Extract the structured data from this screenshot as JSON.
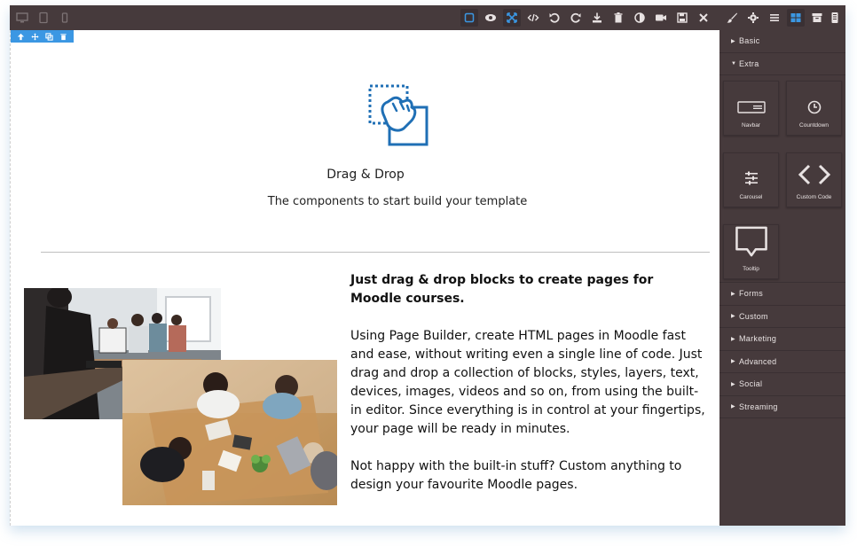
{
  "topbar": {
    "left_icons": [
      "desktop-icon",
      "tablet-icon",
      "mobile-icon"
    ],
    "right_icons": [
      "square-outline-icon",
      "eye-icon",
      "fullscreen-icon",
      "code-icon",
      "undo-icon",
      "redo-icon",
      "import-icon",
      "trash-icon",
      "contrast-icon",
      "video-icon",
      "save-icon",
      "close-icon",
      "brush-icon",
      "gear-icon",
      "layers-icon",
      "blocks-icon",
      "archive-icon",
      "phone-list-icon"
    ]
  },
  "selection_toolbar": {
    "icons": [
      "arrow-up-icon",
      "move-icon",
      "clone-icon",
      "delete-icon"
    ]
  },
  "canvas": {
    "dd_title": "Drag & Drop",
    "dd_subtitle": "The components to start build your template",
    "heading": "Just drag & drop blocks to create pages for Moodle courses.",
    "paragraph1": "Using Page Builder, create HTML pages in Moodle fast and ease, without writing even a single line of code. Just drag and drop a collection of blocks, styles, layers, text, devices, images, videos and so on, from using the built-in editor. Since everything is in control at your fingertips, your page will be ready in minutes.",
    "paragraph2": "Not happy with the built-in stuff? Custom anything to design your favourite Moodle pages."
  },
  "panel": {
    "categories_top": [
      {
        "label": "Basic",
        "expanded": false
      },
      {
        "label": "Extra",
        "expanded": true
      }
    ],
    "blocks": [
      {
        "label": "Navbar",
        "icon": "navbar-icon"
      },
      {
        "label": "Countdown",
        "icon": "clock-icon"
      },
      {
        "label": "Carousel",
        "icon": "sliders-icon"
      },
      {
        "label": "Custom Code",
        "icon": "code-brackets-icon"
      },
      {
        "label": "Tooltip",
        "icon": "tooltip-icon"
      }
    ],
    "categories_bottom": [
      {
        "label": "Forms"
      },
      {
        "label": "Custom"
      },
      {
        "label": "Marketing"
      },
      {
        "label": "Advanced"
      },
      {
        "label": "Social"
      },
      {
        "label": "Streaming"
      }
    ]
  },
  "colors": {
    "dark_panel": "#463a3c",
    "accent_blue": "#3b97e3",
    "icon_light": "#e8e2e2",
    "dd_blue": "#1f6fb5"
  }
}
